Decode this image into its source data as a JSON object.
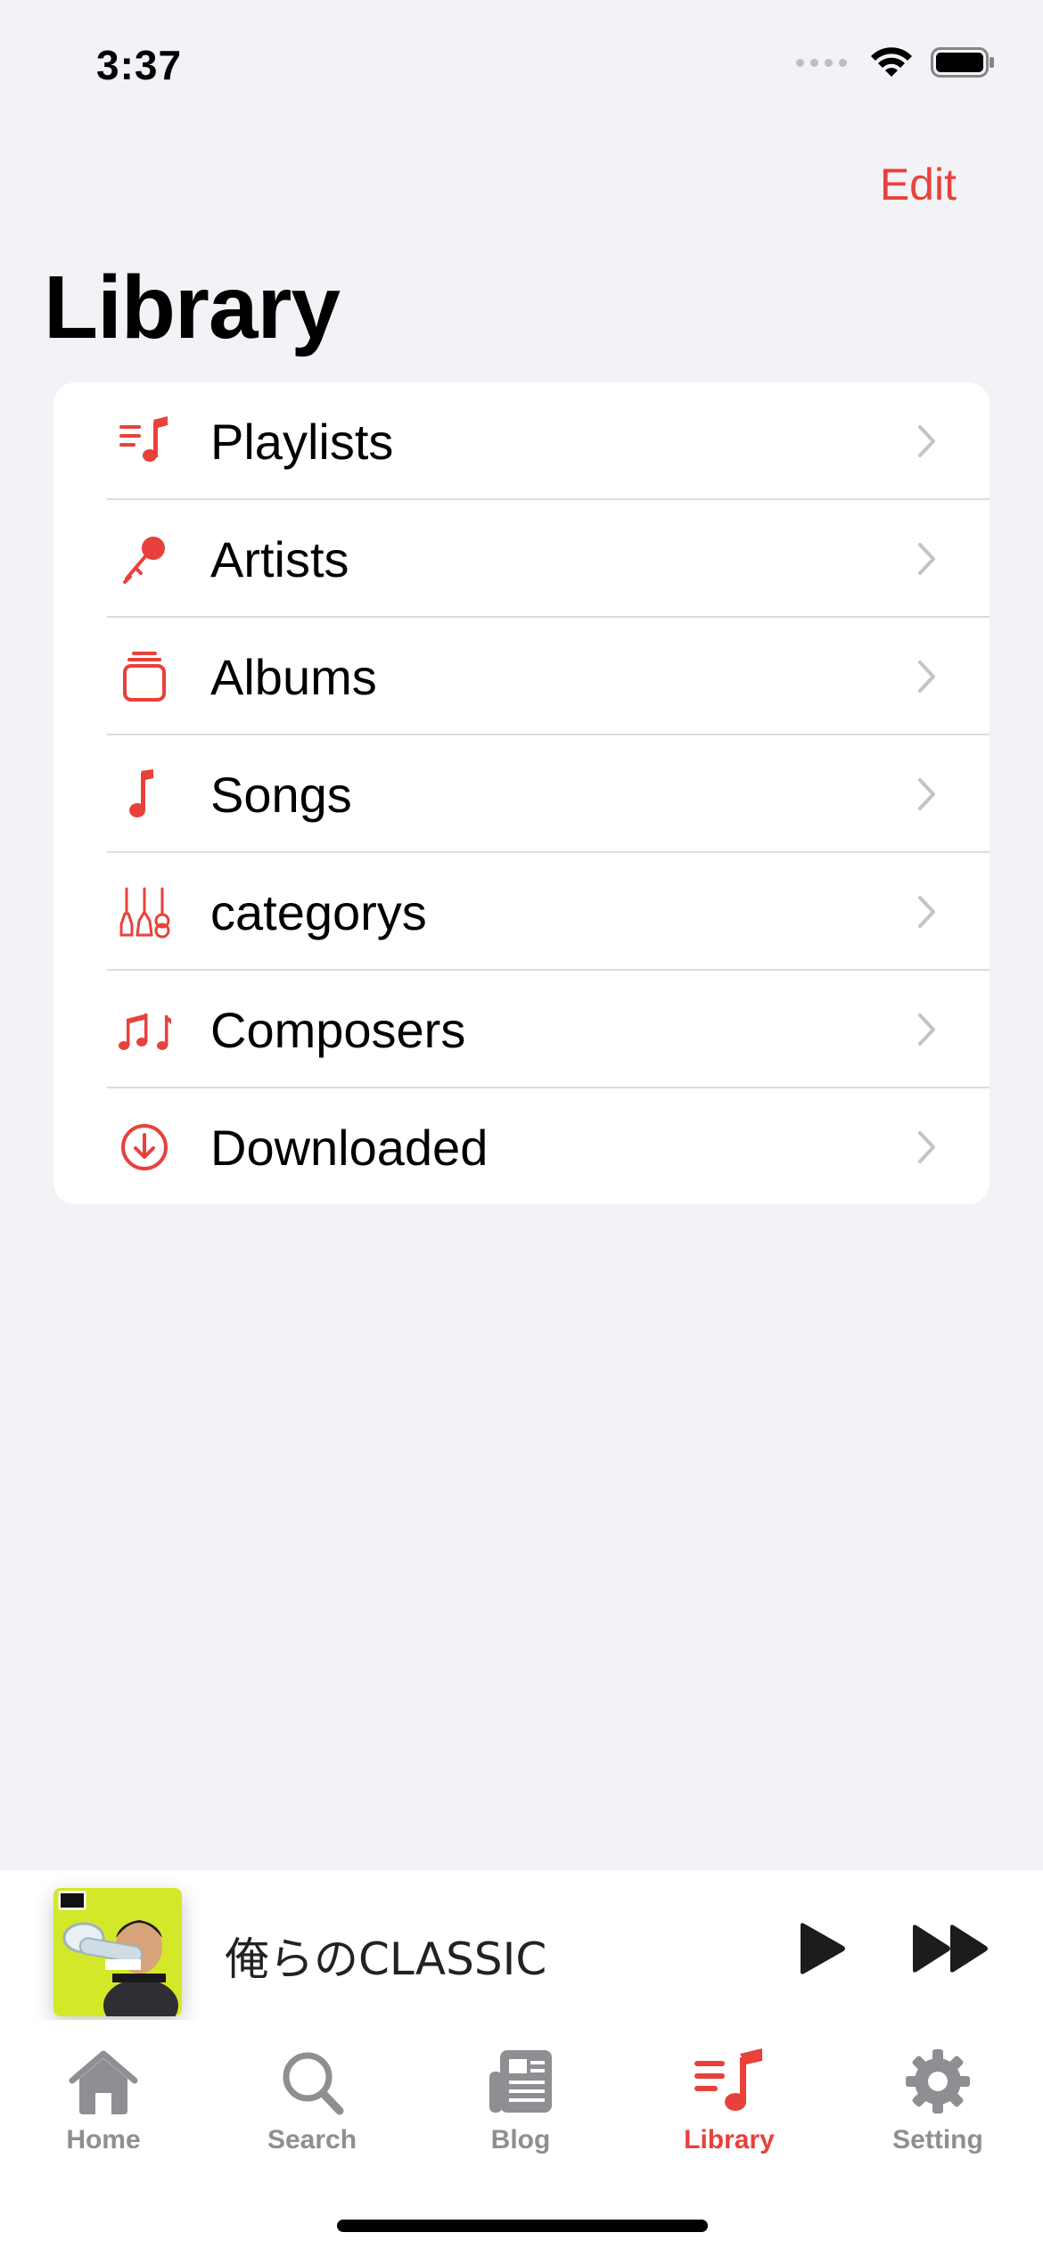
{
  "status_bar": {
    "time": "3:37"
  },
  "nav": {
    "edit_label": "Edit",
    "title": "Library"
  },
  "library_items": [
    {
      "label": "Playlists",
      "icon": "playlist-icon"
    },
    {
      "label": "Artists",
      "icon": "microphone-icon"
    },
    {
      "label": "Albums",
      "icon": "album-stack-icon"
    },
    {
      "label": "Songs",
      "icon": "music-note-icon"
    },
    {
      "label": "categorys",
      "icon": "guitars-icon"
    },
    {
      "label": "Composers",
      "icon": "music-notes-icon"
    },
    {
      "label": "Downloaded",
      "icon": "download-circle-icon"
    }
  ],
  "mini_player": {
    "title": "俺らのCLASSIC",
    "artwork_label": "PARENTAL ADVISORY EXPLICIT CONTENT"
  },
  "tabs": [
    {
      "label": "Home",
      "icon": "house-icon",
      "active": false
    },
    {
      "label": "Search",
      "icon": "magnifier-icon",
      "active": false
    },
    {
      "label": "Blog",
      "icon": "newspaper-icon",
      "active": false
    },
    {
      "label": "Library",
      "icon": "playlist-icon",
      "active": true
    },
    {
      "label": "Setting",
      "icon": "gear-icon",
      "active": false
    }
  ],
  "colors": {
    "accent": "#E8413B",
    "inactive": "#8E8E93",
    "background": "#F2F2F7"
  }
}
